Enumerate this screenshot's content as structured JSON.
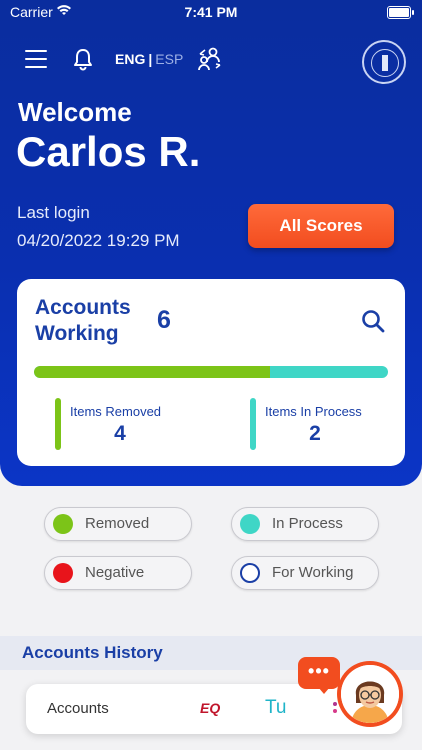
{
  "status_bar": {
    "carrier": "Carrier",
    "time": "7:41 PM"
  },
  "header": {
    "lang_eng": "ENG",
    "lang_sep": "|",
    "lang_esp": "ESP"
  },
  "greeting": {
    "welcome": "Welcome",
    "name": "Carlos R.",
    "last_login_label": "Last login",
    "last_login_value": "04/20/2022 19:29 PM"
  },
  "all_scores_label": "All Scores",
  "accounts_card": {
    "title": "Accounts Working",
    "count": "6",
    "progress_removed_fraction": 0.667,
    "removed_label": "Items Removed",
    "removed_value": "4",
    "in_process_label": "Items In Process",
    "in_process_value": "2"
  },
  "legend": [
    {
      "label": "Removed",
      "color": "#7cc418",
      "style": "filled"
    },
    {
      "label": "In Process",
      "color": "#3fd6c6",
      "style": "filled"
    },
    {
      "label": "Negative",
      "color": "#e8141b",
      "style": "filled"
    },
    {
      "label": "For Working",
      "color": "#1a3fa6",
      "style": "outline"
    }
  ],
  "history": {
    "title": "Accounts History",
    "accounts_label": "Accounts",
    "bureau_eq": "EQ",
    "bureau_tu": "Tu"
  },
  "chat": {
    "dots": "•••"
  },
  "colors": {
    "brand_blue": "#0a2d9e",
    "accent_orange": "#f24d1f",
    "removed_green": "#7cc418",
    "process_teal": "#3fd6c6"
  }
}
